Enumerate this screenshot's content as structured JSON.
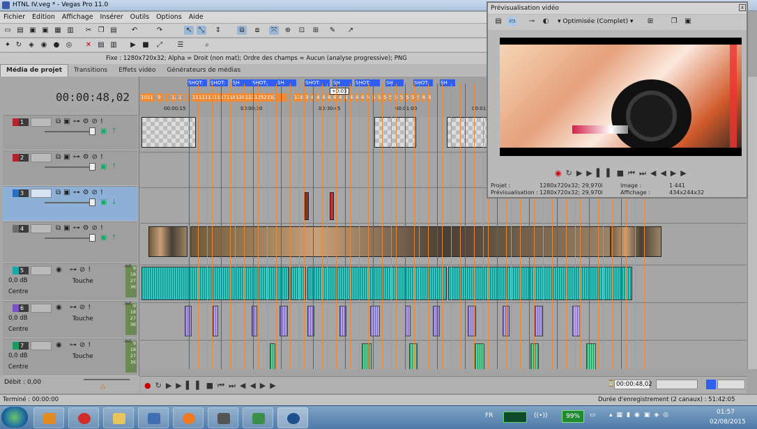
{
  "window": {
    "title": "HTNL IV.veg * - Vegas Pro 11.0"
  },
  "menu": [
    "Fichier",
    "Edition",
    "Affichage",
    "Insérer",
    "Outils",
    "Options",
    "Aide"
  ],
  "infobar": {
    "text": "Fixe : 1280x720x32; Alpha = Droit (non mat); Ordre des champs = Aucun (analyse progressive); PNG"
  },
  "tabs": [
    "Média de projet",
    "Transitions",
    "Effets vidéo",
    "Générateurs de médias"
  ],
  "timecode": "00:00:48,02",
  "ruler": {
    "ticks": [
      "00:00:15",
      "00:00:30",
      "00:00:45",
      "00:01:00",
      "00:01:15"
    ],
    "cursor_label": "+0:03"
  },
  "markers": [
    "SHOT:",
    "SHOT:",
    "SH",
    "SHOT:",
    "SH",
    "SHOT:",
    "SH",
    "SHOT:",
    "SH",
    "SHOT:",
    "SH"
  ],
  "regions": [
    "1011",
    "9",
    "",
    "12",
    "13",
    "",
    "",
    "1111111111711812812212522322830",
    "",
    "",
    "138",
    "39",
    "40",
    "41",
    "42",
    "43",
    "44",
    "45",
    "46",
    "47",
    "48",
    "49",
    "50",
    "51",
    "52",
    "53",
    "54",
    "55",
    "56",
    "57",
    "58",
    "59",
    "60",
    "6155666666"
  ],
  "tracks": [
    {
      "num": "1",
      "type": "video",
      "color": "#b4222d"
    },
    {
      "num": "2",
      "type": "video",
      "color": "#b4222d"
    },
    {
      "num": "3",
      "type": "video",
      "color": "#2a6fbf",
      "selected": true
    },
    {
      "num": "4",
      "type": "video",
      "color": "#6b6b6b"
    },
    {
      "num": "5",
      "type": "audio",
      "color": "#1aa9a9",
      "vol": "0,0 dB",
      "pan": "Centre",
      "mode": "Touche"
    },
    {
      "num": "6",
      "type": "audio",
      "color": "#7a52c4",
      "vol": "0,0 dB",
      "pan": "Centre",
      "mode": "Touche"
    },
    {
      "num": "7",
      "type": "audio",
      "color": "#1a9a60",
      "vol": "0,0 dB",
      "pan": "Centre",
      "mode": "Touche"
    }
  ],
  "meter_labels": [
    "-Inf.",
    "9",
    "18",
    "27",
    "36"
  ],
  "transport": {
    "time": "00:00:48,02"
  },
  "debit": "Débit : 0,00",
  "status": {
    "left": "Terminé : 00:00:00",
    "right": "Durée d'enregistrement (2 canaux) : 51:42:05"
  },
  "preview": {
    "title": "Prévisualisation vidéo",
    "quality": "Optimisée (Complet)",
    "projet_label": "Projet :",
    "projet": "1280x720x32; 29,970i",
    "prev_label": "Prévisualisation :",
    "prev": "1280x720x32; 29,970i",
    "image_label": "Image :",
    "image": "1 441",
    "aff_label": "Affichage :",
    "aff": "434x244x32"
  },
  "taskbar": {
    "lang": "FR",
    "battery": "99%",
    "time": "01:57",
    "date": "02/08/2015"
  }
}
